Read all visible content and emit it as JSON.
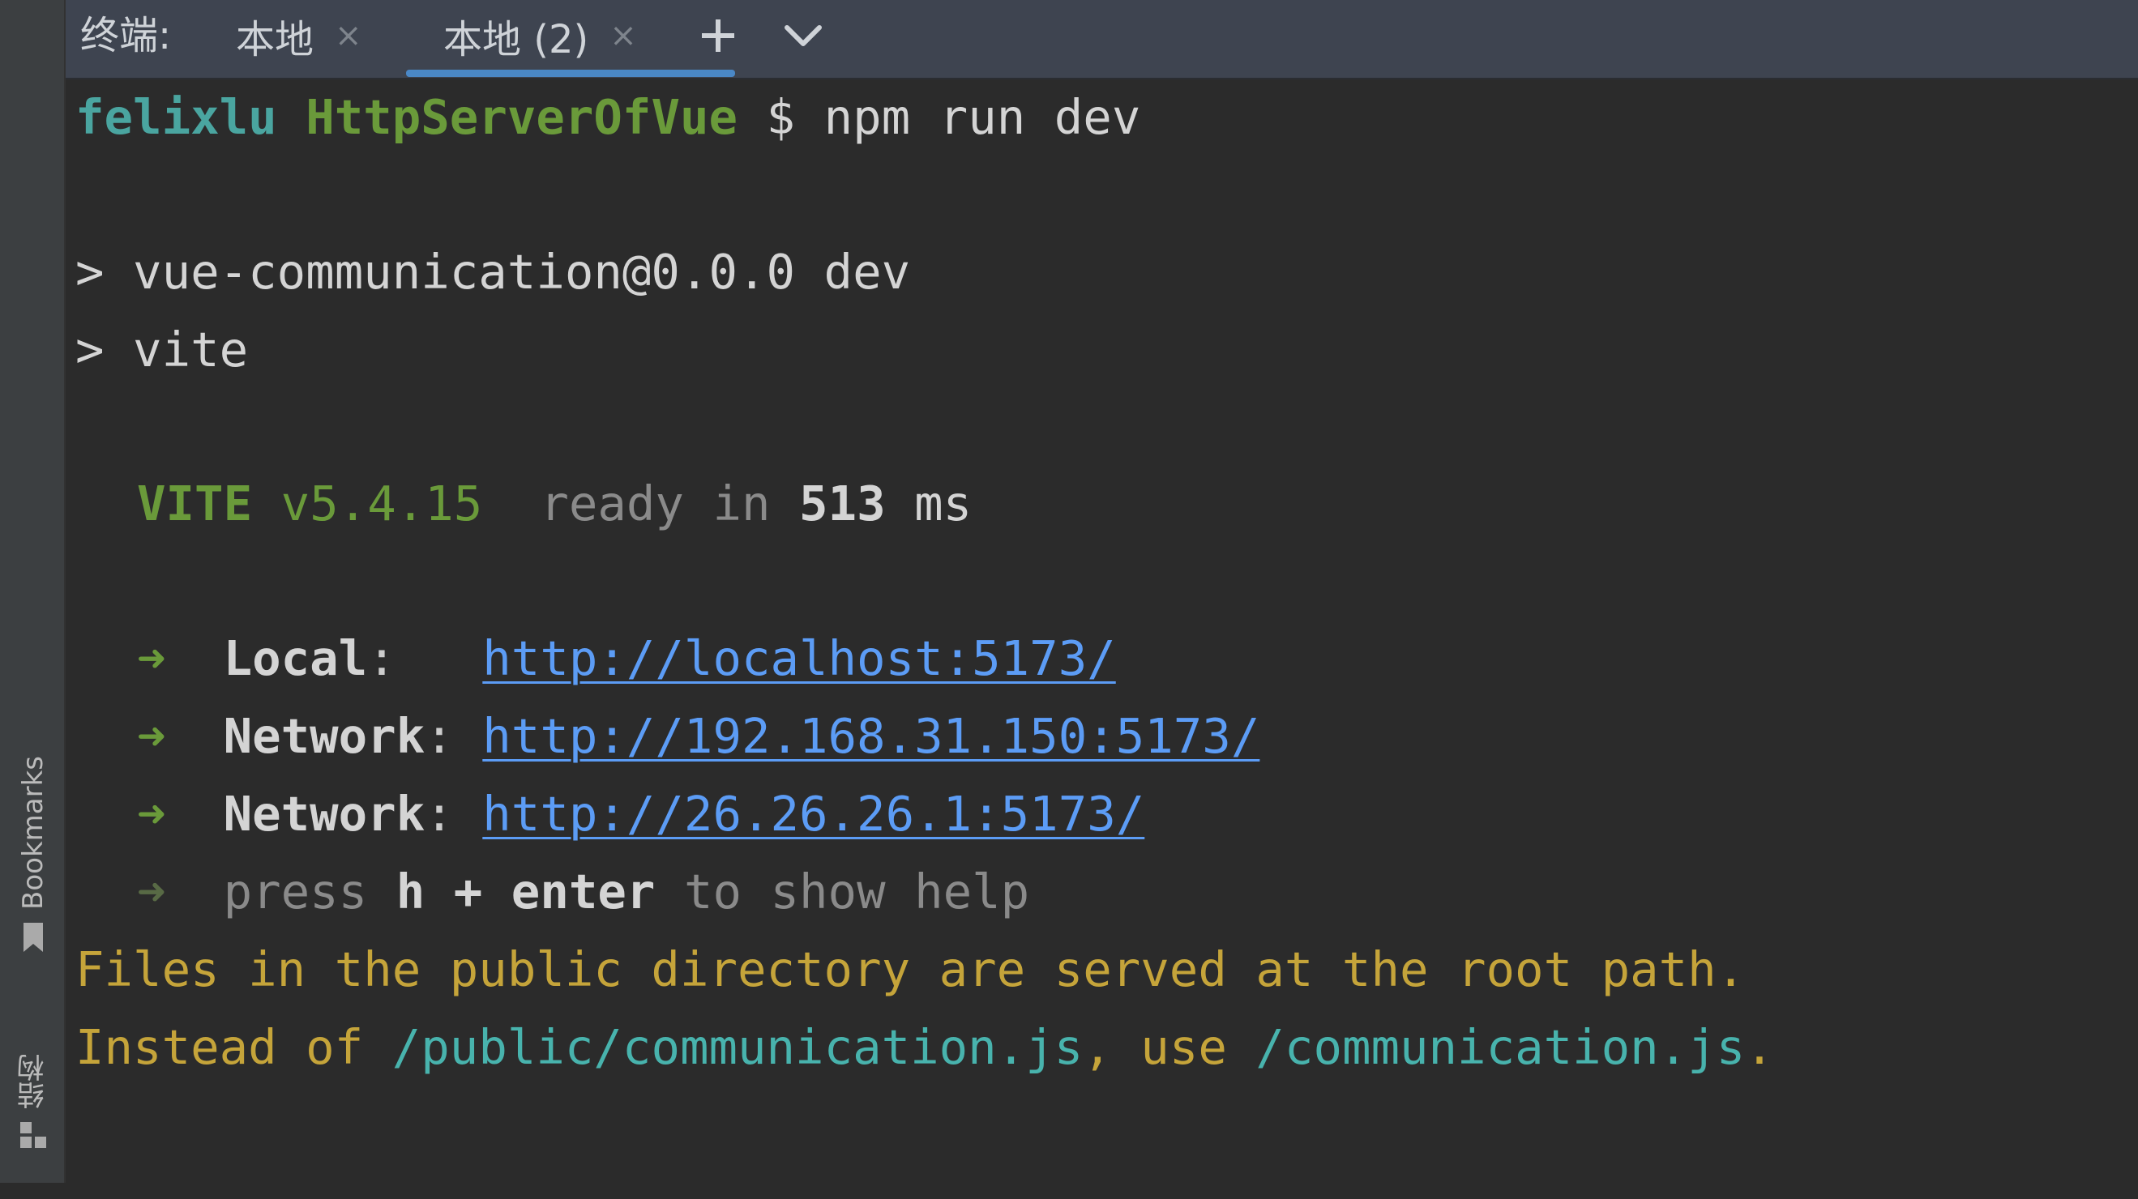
{
  "tabbar": {
    "prefix": "终端:",
    "tabs": [
      {
        "label": "本地",
        "close": "×"
      },
      {
        "label": "本地 (2)",
        "close": "×"
      }
    ],
    "add_label": "+",
    "active_tab": 1
  },
  "sidebar": {
    "bookmarks_label": "Bookmarks",
    "structure_label": "结构"
  },
  "terminal": {
    "prompt_user": "felixlu",
    "prompt_dir": "HttpServerOfVue",
    "prompt_symbol": "$",
    "command": "npm run dev",
    "script_line_1": "> vue-communication@0.0.0 dev",
    "script_line_2": "> vite",
    "vite_name": "VITE",
    "vite_version": "v5.4.15",
    "ready_prefix": "ready in",
    "ready_ms": "513",
    "ready_unit": "ms",
    "arrow": "➜",
    "local_label": "Local",
    "local_url": "http://localhost:5173/",
    "network_label": "Network",
    "network_url_1": "http://192.168.31.150:5173/",
    "network_url_2": "http://26.26.26.1:5173/",
    "help_press": "press",
    "help_keys": "h + enter",
    "help_suffix": "to show help",
    "warning_line_1": "Files in the public directory are served at the root path.",
    "warning_2_prefix": "Instead of",
    "warning_2_path1": "/public/communication.js",
    "warning_2_mid": ", use",
    "warning_2_path2": "/communication.js",
    "warning_2_end": "."
  },
  "colors": {
    "background": "#2b2b2b",
    "sidebar": "#3c3f41",
    "tabbar": "#3e4450",
    "accent": "#4a88c7",
    "prompt_user": "#4aa5a0",
    "prompt_dir": "#6a9a3a",
    "link": "#5c9cf5",
    "warning": "#c5a43a"
  }
}
